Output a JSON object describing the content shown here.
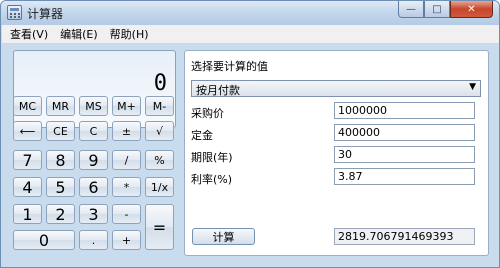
{
  "window": {
    "title": "计算器"
  },
  "caption": {
    "minimize": "—",
    "maximize": "□",
    "close": "✕"
  },
  "menu": [
    "查看(V)",
    "编辑(E)",
    "帮助(H)"
  ],
  "display": {
    "value": "0"
  },
  "keys": {
    "mc": "MC",
    "mr": "MR",
    "ms": "MS",
    "mplus": "M+",
    "mminus": "M-",
    "backspace": "⟵",
    "ce": "CE",
    "c": "C",
    "plusminus": "±",
    "sqrt": "√",
    "d7": "7",
    "d8": "8",
    "d9": "9",
    "divide": "/",
    "percent": "%",
    "d4": "4",
    "d5": "5",
    "d6": "6",
    "multiply": "*",
    "reciprocal": "1/x",
    "d1": "1",
    "d2": "2",
    "d3": "3",
    "minus": "-",
    "equals": "=",
    "d0": "0",
    "dot": ".",
    "plus": "+"
  },
  "mortgage": {
    "heading": "选择要计算的值",
    "select_value": "按月付款",
    "fields": [
      {
        "label": "采购价",
        "value": "1000000"
      },
      {
        "label": "定金",
        "value": "400000"
      },
      {
        "label": "期限(年)",
        "value": "30"
      },
      {
        "label": "利率(%)",
        "value": "3.87"
      }
    ],
    "calculate_label": "计算",
    "result": "2819.706791469393"
  }
}
